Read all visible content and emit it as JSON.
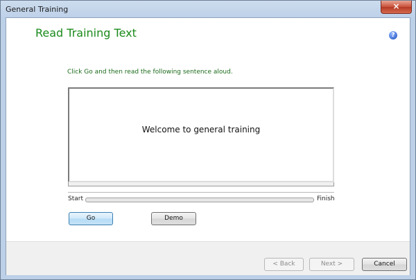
{
  "window": {
    "title": "General Training",
    "close_glyph": "×"
  },
  "page": {
    "heading": "Read Training Text",
    "help_glyph": "?",
    "instruction": "Click Go and then read the following sentence aloud.",
    "sentence": "Welcome to general training"
  },
  "progress": {
    "start_label": "Start",
    "finish_label": "Finish",
    "value": 0
  },
  "buttons": {
    "go": "Go",
    "demo": "Demo",
    "back": "< Back",
    "next": "Next >",
    "cancel": "Cancel"
  },
  "colors": {
    "heading": "#1a8a1a",
    "instruction": "#1a6a1a"
  }
}
